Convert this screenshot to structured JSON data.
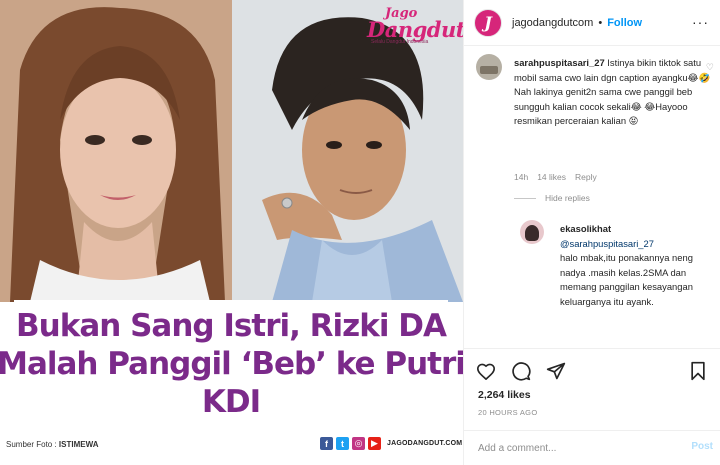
{
  "image": {
    "logo": {
      "top": "Jago",
      "main": "Dangdut",
      "tagline": "Selalu Dangdut Indonesia"
    },
    "headline": [
      "Bukan Sang Istri, Rizki DA",
      "Malah Panggil ‘Beb’ ke Putri",
      "KDI"
    ],
    "credit_label": "Sumber Foto : ",
    "credit_value": "ISTIMEWA",
    "site_url": "JAGODANGDUT.COM",
    "social_icons": [
      "facebook-icon",
      "twitter-icon",
      "instagram-icon",
      "youtube-icon"
    ],
    "colors": {
      "headline": "#7b2a8a",
      "brand": "#d6267a"
    }
  },
  "header": {
    "avatar_letter": "J",
    "username": "jagodangdutcom",
    "separator": "•",
    "follow_label": "Follow",
    "more_label": "···"
  },
  "comments": [
    {
      "username": "sarahpuspitasari_27",
      "text": "Istinya bikin tiktok satu mobil sama cwo lain dgn caption ayangku😂🤣 Nah lakinya genit2n sama cwe panggil beb sungguh kalian cocok sekali😂 😂Hayooo resmikan perceraian kalian 😝",
      "time": "14h",
      "likes": "14 likes",
      "reply_label": "Reply"
    }
  ],
  "hide_replies_label": "Hide replies",
  "reply": {
    "username": "ekasolikhat",
    "mention": "@sarahpuspitasari_27",
    "text": "halo mbak,itu ponakannya neng nadya .masih kelas.2SMA dan memang panggilan kesayangan keluarganya itu ayank."
  },
  "actions": {
    "likes": "2,264 likes",
    "time": "20 HOURS AGO"
  },
  "add_comment": {
    "placeholder": "Add a comment...",
    "post_label": "Post"
  }
}
